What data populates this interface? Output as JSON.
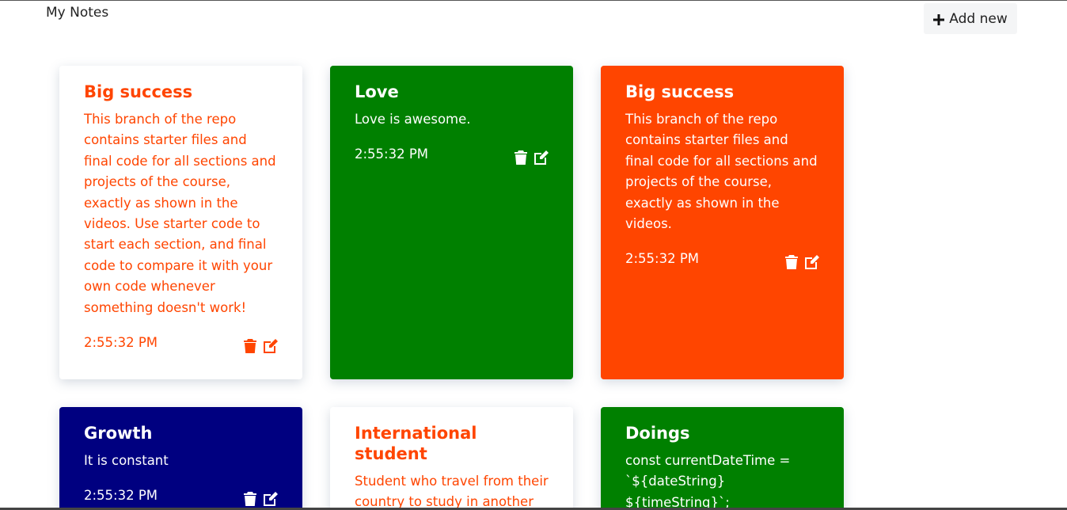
{
  "header": {
    "title": "My Notes",
    "add_label": "Add new"
  },
  "colors": {
    "white": "#ffffff",
    "green": "#008000",
    "orange": "#ff4500",
    "navy": "#000080"
  },
  "notes": [
    {
      "title": "Big success",
      "body": "This branch of the repo contains starter files and final code for all sections and projects of the course, exactly as shown in the videos. Use starter code to start each section, and final code to compare it with your own code whenever something doesn't work!",
      "time": "2:55:32 PM",
      "bg": "#ffffff",
      "fg": "#ff4500"
    },
    {
      "title": "Love",
      "body": "Love is awesome.",
      "time": "2:55:32 PM",
      "bg": "#008000",
      "fg": "#ffffff"
    },
    {
      "title": "Big success",
      "body": "This branch of the repo contains starter files and final code for all sections and projects of the course, exactly as shown in the videos.",
      "time": "2:55:32 PM",
      "bg": "#ff4500",
      "fg": "#ffffff"
    },
    {
      "title": "Growth",
      "body": "It is constant",
      "time": "2:55:32 PM",
      "bg": "#000080",
      "fg": "#ffffff"
    },
    {
      "title": "International student",
      "body": "Student who travel from their country to study in another country.",
      "time": "",
      "bg": "#ffffff",
      "fg": "#ff4500"
    },
    {
      "title": "Doings",
      "body": "const currentDateTime = `${dateString} ${timeString}`; console.log(currentDateTime);",
      "time": "",
      "bg": "#008000",
      "fg": "#ffffff"
    }
  ],
  "icons": {
    "delete": "trash-icon",
    "edit": "edit-icon",
    "add": "plus-icon"
  }
}
